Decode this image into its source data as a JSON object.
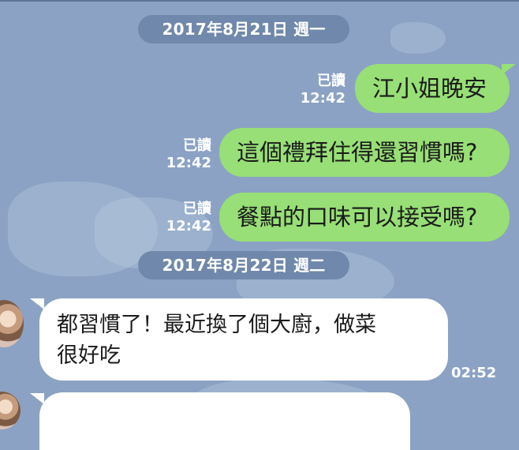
{
  "dates": {
    "first": "2017年8月21日 週一",
    "second": "2017年8月22日 週二"
  },
  "messages": [
    {
      "direction": "outgoing",
      "text": "江小姐晚安",
      "status": "已讀",
      "time": "12:42"
    },
    {
      "direction": "outgoing",
      "text": "這個禮拜住得還習慣嗎?",
      "status": "已讀",
      "time": "12:42"
    },
    {
      "direction": "outgoing",
      "text": "餐點的口味可以接受嗎?",
      "status": "已讀",
      "time": "12:42"
    },
    {
      "direction": "incoming",
      "line1": "都習慣了！最近換了個大廚，做菜",
      "line2": "很好吃",
      "time": "02:52"
    }
  ],
  "colors": {
    "background": "#8ba2c4",
    "outgoing_bubble": "#97df76",
    "incoming_bubble": "#ffffff",
    "date_pill": "#7088ab"
  }
}
